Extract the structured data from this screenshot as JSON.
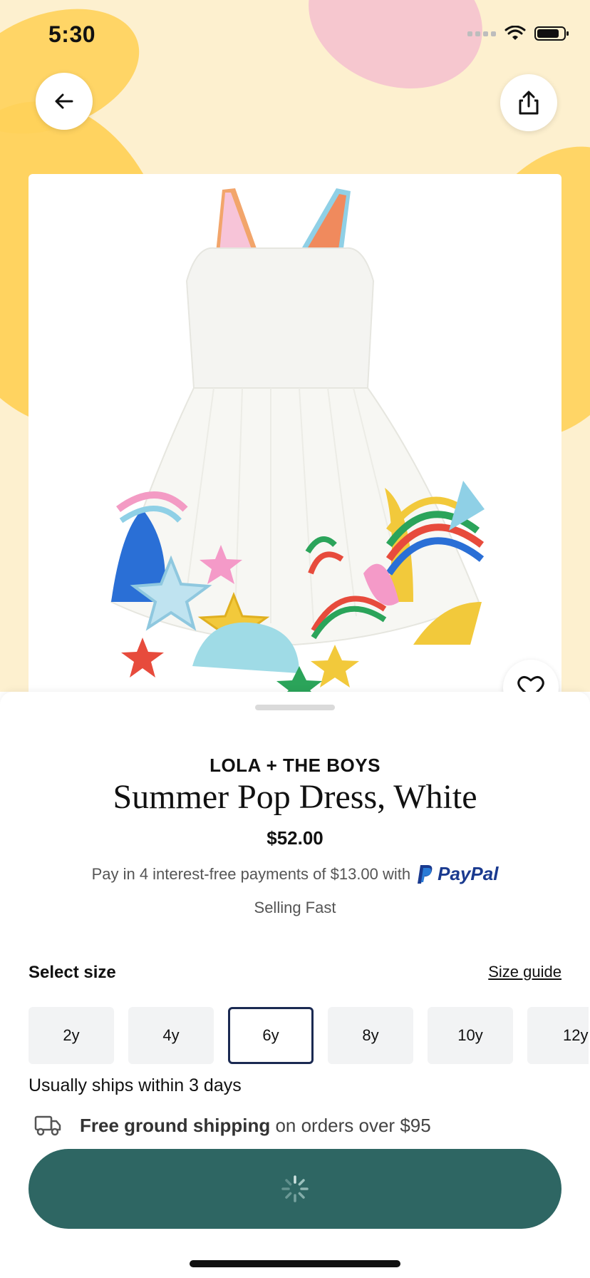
{
  "status_bar": {
    "time": "5:30"
  },
  "icons": {
    "back": "arrow-left-icon",
    "share": "share-icon",
    "favorite": "heart-icon",
    "wifi": "wifi-icon",
    "battery": "battery-icon",
    "shipping": "truck-icon",
    "loading": "spinner-icon"
  },
  "product": {
    "brand": "LOLA + THE BOYS",
    "title": "Summer Pop Dress, White",
    "price": "$52.00",
    "paypal_text": "Pay in 4 interest-free payments of $13.00 with",
    "paypal_brand": "PayPal",
    "stock_note": "Selling Fast"
  },
  "size_section": {
    "label": "Select size",
    "guide_link": "Size guide",
    "sizes": [
      "2y",
      "4y",
      "6y",
      "8y",
      "10y",
      "12y"
    ],
    "selected": "6y"
  },
  "shipping_info": {
    "ships_note": "Usually ships within 3 days",
    "free_bold": "Free ground shipping",
    "free_rest": "on orders over $95"
  },
  "colors": {
    "accent": "#2e6663",
    "selected_border": "#1b2a52",
    "paypal_dark": "#1a3a8f",
    "paypal_light": "#2a7bd6",
    "hero_bg": "#fdf0cf"
  }
}
